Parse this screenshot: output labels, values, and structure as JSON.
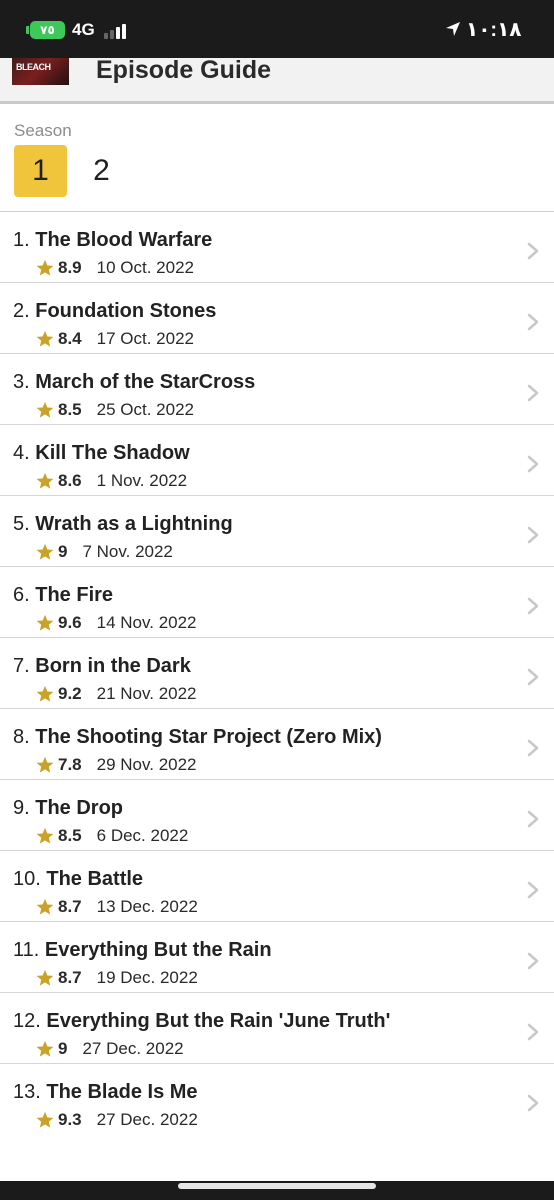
{
  "status_bar": {
    "battery": "٧٥",
    "network": "4G",
    "time": "١٠:١٨"
  },
  "header": {
    "thumbnail_text": "BLEACH",
    "title": "Episode Guide"
  },
  "season": {
    "label": "Season",
    "options": [
      "1",
      "2"
    ],
    "selected": "1"
  },
  "colors": {
    "accent": "#f0c43b",
    "star": "#c9a227",
    "chevron": "#c8c8c8"
  },
  "episodes": [
    {
      "number": "1.",
      "title": "The Blood Warfare",
      "rating": "8.9",
      "date": "10 Oct. 2022"
    },
    {
      "number": "2.",
      "title": "Foundation Stones",
      "rating": "8.4",
      "date": "17 Oct. 2022"
    },
    {
      "number": "3.",
      "title": "March of the StarCross",
      "rating": "8.5",
      "date": "25 Oct. 2022"
    },
    {
      "number": "4.",
      "title": "Kill The Shadow",
      "rating": "8.6",
      "date": "1 Nov. 2022"
    },
    {
      "number": "5.",
      "title": "Wrath as a Lightning",
      "rating": "9",
      "date": "7 Nov. 2022"
    },
    {
      "number": "6.",
      "title": "The Fire",
      "rating": "9.6",
      "date": "14 Nov. 2022"
    },
    {
      "number": "7.",
      "title": "Born in the Dark",
      "rating": "9.2",
      "date": "21 Nov. 2022"
    },
    {
      "number": "8.",
      "title": "The Shooting Star Project (Zero Mix)",
      "rating": "7.8",
      "date": "29 Nov. 2022"
    },
    {
      "number": "9.",
      "title": "The Drop",
      "rating": "8.5",
      "date": "6 Dec. 2022"
    },
    {
      "number": "10.",
      "title": "The Battle",
      "rating": "8.7",
      "date": "13 Dec. 2022"
    },
    {
      "number": "11.",
      "title": "Everything But the Rain",
      "rating": "8.7",
      "date": "19 Dec. 2022"
    },
    {
      "number": "12.",
      "title": "Everything But the Rain 'June Truth'",
      "rating": "9",
      "date": "27 Dec. 2022"
    },
    {
      "number": "13.",
      "title": "The Blade Is Me",
      "rating": "9.3",
      "date": "27 Dec. 2022"
    }
  ]
}
